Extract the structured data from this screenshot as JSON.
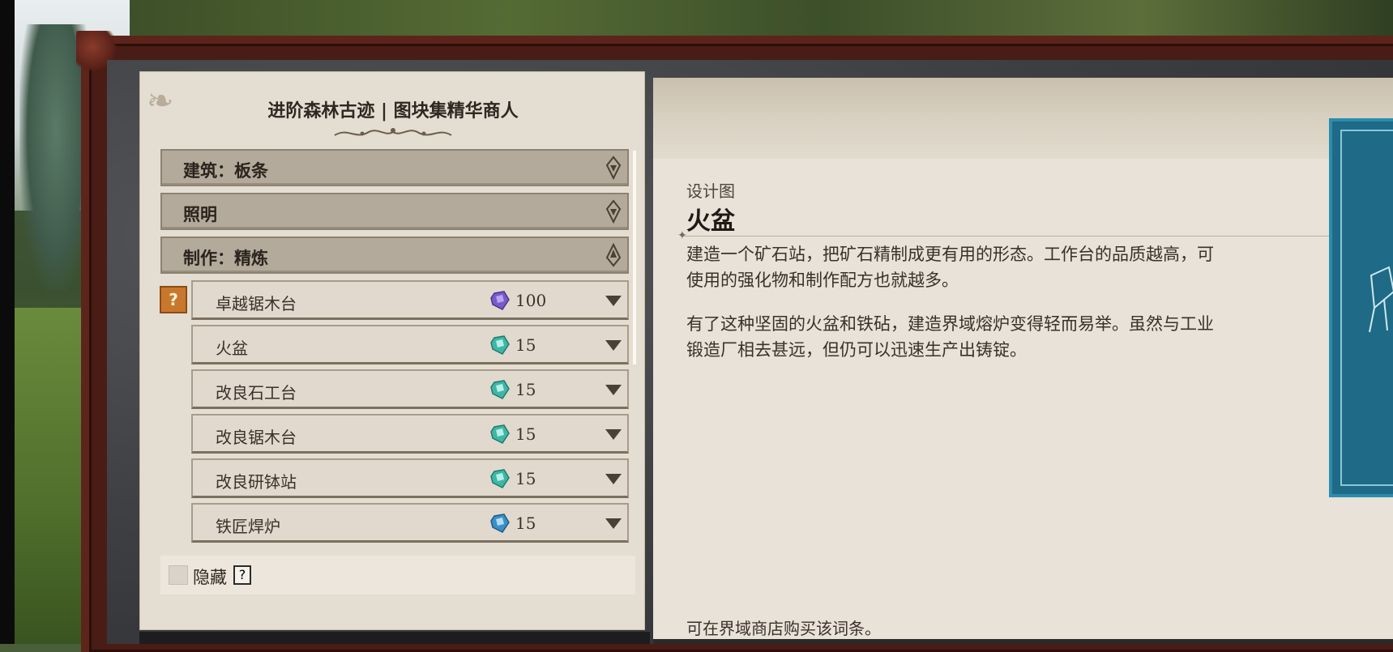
{
  "left_panel": {
    "title": "进阶森林古迹 | 图块集精华商人",
    "categories": [
      {
        "label": "建筑：板条",
        "expanded": false
      },
      {
        "label": "照明",
        "expanded": false
      },
      {
        "label": "制作：精炼",
        "expanded": true
      }
    ],
    "items": [
      {
        "label": "卓越锯木台",
        "price": "100",
        "gem": "purple"
      },
      {
        "label": "火盆",
        "price": "15",
        "gem": "teal"
      },
      {
        "label": "改良石工台",
        "price": "15",
        "gem": "teal"
      },
      {
        "label": "改良锯木台",
        "price": "15",
        "gem": "teal"
      },
      {
        "label": "改良研钵站",
        "price": "15",
        "gem": "teal"
      },
      {
        "label": "铁匠焊炉",
        "price": "15",
        "gem": "blue"
      }
    ],
    "help_badge": "?",
    "hide": {
      "label": "隐藏",
      "checked": false,
      "help": "?"
    }
  },
  "detail": {
    "subtitle": "设计图",
    "title": "火盆",
    "paragraphs": [
      "建造一个矿石站，把矿石精制成更有用的形态。工作台的品质越高，可使用的强化物和制作配方也就越多。",
      "有了这种坚固的火盆和铁砧，建造界域熔炉变得轻而易举。虽然与工业锻造厂相去甚远，但仍可以迅速生产出铸锭。"
    ],
    "footer": "可在界域商店购买该词条。"
  },
  "colors": {
    "gem_purple": "#7a5ac8",
    "gem_teal": "#3fb7a6",
    "gem_blue": "#3a8fc7",
    "category_bg": "#b3aa9b",
    "panel_bg": "#e4ddd2",
    "blueprint": "#1f6a86"
  },
  "icons": {
    "category_collapsed": "drop-pin-down-icon",
    "category_expanded": "drop-pin-up-icon",
    "item_expand": "triangle-down-icon",
    "help": "question-card-icon"
  }
}
